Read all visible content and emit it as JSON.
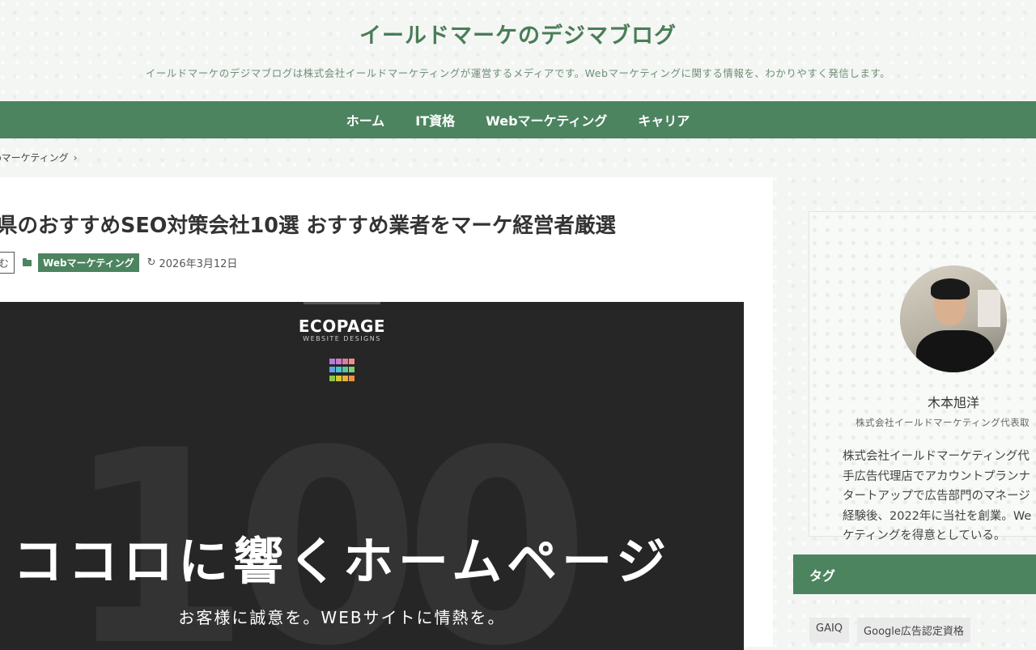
{
  "header": {
    "title": "イールドマーケのデジマブログ",
    "description": "イールドマーケのデジマブログは株式会社イールドマーケティングが運営するメディアです。Webマーケティングに関する情報を、わかりやすく発信します。"
  },
  "nav": {
    "items": [
      {
        "label": "ホーム"
      },
      {
        "label": "IT資格"
      },
      {
        "label": "Webマーケティング"
      },
      {
        "label": "キャリア"
      }
    ]
  },
  "breadcrumb": {
    "label": "bマーケティング",
    "chevron": "›"
  },
  "article": {
    "title": "県のおすすめSEO対策会社10選 おすすめ業者をマーケ経営者厳選",
    "meta": {
      "tag_fragment": "む",
      "category": "Webマーケティング",
      "update_icon": "refresh-icon",
      "date": "2026年3月12日"
    },
    "hero": {
      "logo": "ECOPAGE",
      "logo_sub": "WEBSITE DESIGNS",
      "big_number": "100",
      "main_copy": "ココロに響くホームページ",
      "sub_copy": "お客様に誠意を。WEBサイトに情熱を。",
      "grid_colors": [
        "#b07fd6",
        "#c77bc9",
        "#e07aa6",
        "#f08c8c",
        "#5fa4e6",
        "#4fc0d8",
        "#58c6a0",
        "#7fcf6a",
        "#8ac84a",
        "#d4c83a",
        "#e8b23a",
        "#f0913a"
      ]
    }
  },
  "sidebar": {
    "profile": {
      "name": "木本旭洋",
      "role": "株式会社イールドマーケティング代表取",
      "bio": "株式会社イールドマーケティング代\n手広告代理店でアカウントプランナ\nタートアップで広告部門のマネージ\n経験後、2022年に当社を創業。We\nケティングを得意としている。"
    },
    "tag_heading": "タグ",
    "tags": [
      "GAIQ",
      "Google広告認定資格"
    ]
  },
  "colors": {
    "accent": "#4c8460",
    "title": "#4a7d58",
    "hero_bg": "#262626"
  }
}
